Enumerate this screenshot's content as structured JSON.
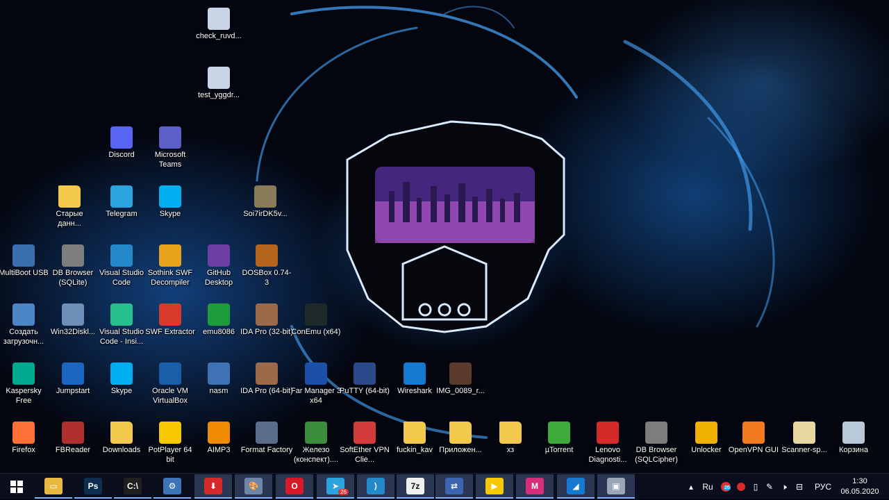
{
  "desktop_icons": [
    {
      "label": "check_ruvd...",
      "icon": "config-file-icon",
      "color": "#c9d4e6"
    },
    {
      "label": "test_yggdr...",
      "icon": "config-file-icon",
      "color": "#c9d4e6"
    },
    {
      "label": "Discord",
      "icon": "discord-icon",
      "color": "#5865f2"
    },
    {
      "label": "Microsoft Teams",
      "icon": "teams-icon",
      "color": "#5b5fc7"
    },
    {
      "label": "Старые данн...",
      "icon": "folder-icon",
      "color": "#f2c94c"
    },
    {
      "label": "Telegram",
      "icon": "telegram-icon",
      "color": "#2aa3de"
    },
    {
      "label": "Skype",
      "icon": "skype-icon",
      "color": "#00aff0"
    },
    {
      "label": "Soi7irDK5v...",
      "icon": "image-file-icon",
      "color": "#8a7a5a"
    },
    {
      "label": "MultiBoot USB",
      "icon": "multiboot-icon",
      "color": "#3a6fb0"
    },
    {
      "label": "DB Browser (SQLite)",
      "icon": "database-icon",
      "color": "#7d7d7d"
    },
    {
      "label": "Visual Studio Code",
      "icon": "vscode-icon",
      "color": "#2489ca"
    },
    {
      "label": "Sothink SWF Decompiler",
      "icon": "sothink-icon",
      "color": "#e7a31b"
    },
    {
      "label": "GitHub Desktop",
      "icon": "github-desktop-icon",
      "color": "#6e3fa3"
    },
    {
      "label": "DOSBox 0.74-3",
      "icon": "dosbox-icon",
      "color": "#b5651d"
    },
    {
      "label": "Создать загрузочн...",
      "icon": "boot-media-icon",
      "color": "#4c86c6"
    },
    {
      "label": "Win32Diskl...",
      "icon": "disk-imager-icon",
      "color": "#6d8fb8"
    },
    {
      "label": "Visual Studio Code - Insi...",
      "icon": "vscode-insiders-icon",
      "color": "#24bf8a"
    },
    {
      "label": "SWF Extractor",
      "icon": "swf-extractor-icon",
      "color": "#d93a2b"
    },
    {
      "label": "emu8086",
      "icon": "emu8086-icon",
      "color": "#1e9c3c"
    },
    {
      "label": "IDA Pro (32-bit)",
      "icon": "ida-pro-icon",
      "color": "#9b6a4b"
    },
    {
      "label": "ConEmu (x64)",
      "icon": "conemu-icon",
      "color": "#1e2a2a"
    },
    {
      "label": "Kaspersky Free",
      "icon": "kaspersky-icon",
      "color": "#00a88e"
    },
    {
      "label": "Jumpstart",
      "icon": "jumpstart-icon",
      "color": "#1c66c2"
    },
    {
      "label": "Skype",
      "icon": "skype-icon",
      "color": "#00aff0"
    },
    {
      "label": "Oracle VM VirtualBox",
      "icon": "virtualbox-icon",
      "color": "#1b5ea8"
    },
    {
      "label": "nasm",
      "icon": "nasm-icon",
      "color": "#3f72b5"
    },
    {
      "label": "IDA Pro (64-bit)",
      "icon": "ida-pro-icon",
      "color": "#9b6a4b"
    },
    {
      "label": "Far Manager 3 x64",
      "icon": "far-manager-icon",
      "color": "#1c4fa8"
    },
    {
      "label": "PuTTY (64-bit)",
      "icon": "putty-icon",
      "color": "#2a4a8a"
    },
    {
      "label": "Wireshark",
      "icon": "wireshark-icon",
      "color": "#1679d1"
    },
    {
      "label": "IMG_0089_r...",
      "icon": "image-file-icon",
      "color": "#5a3a2a"
    },
    {
      "label": "Firefox",
      "icon": "firefox-icon",
      "color": "#ff7139"
    },
    {
      "label": "FBReader",
      "icon": "fbreader-icon",
      "color": "#b03030"
    },
    {
      "label": "Downloads",
      "icon": "folder-icon",
      "color": "#f2c94c"
    },
    {
      "label": "PotPlayer 64 bit",
      "icon": "potplayer-icon",
      "color": "#f6c800"
    },
    {
      "label": "AIMP3",
      "icon": "aimp-icon",
      "color": "#f08a00"
    },
    {
      "label": "Format Factory",
      "icon": "format-factory-icon",
      "color": "#5a6d8a"
    },
    {
      "label": "Железо (конспект)....",
      "icon": "document-icon",
      "color": "#3b8c3b"
    },
    {
      "label": "SoftEther VPN Clie...",
      "icon": "softether-icon",
      "color": "#d33b3b"
    },
    {
      "label": "fuckin_kav",
      "icon": "folder-icon",
      "color": "#f2c94c"
    },
    {
      "label": "Приложен...",
      "icon": "folder-icon",
      "color": "#f2c94c"
    },
    {
      "label": "хз",
      "icon": "folder-icon",
      "color": "#f2c94c"
    },
    {
      "label": "µTorrent",
      "icon": "utorrent-icon",
      "color": "#3cab3c"
    },
    {
      "label": "Lenovo Diagnosti...",
      "icon": "lenovo-diagnostics-icon",
      "color": "#d62a2a"
    },
    {
      "label": "DB Browser (SQLCipher)",
      "icon": "database-icon",
      "color": "#7d7d7d"
    },
    {
      "label": "Unlocker",
      "icon": "unlocker-icon",
      "color": "#f0b000"
    },
    {
      "label": "OpenVPN GUI",
      "icon": "openvpn-icon",
      "color": "#f47a20"
    },
    {
      "label": "Scanner-sp...",
      "icon": "scanner-icon",
      "color": "#e8d7a0"
    },
    {
      "label": "Корзина",
      "icon": "recycle-bin-icon",
      "color": "#b9c9d9"
    }
  ],
  "taskbar": {
    "start_icon": "windows-logo-icon",
    "apps": [
      {
        "name": "file-explorer-icon",
        "glyph": "▭",
        "color": "#e8b740"
      },
      {
        "name": "photoshop-icon",
        "glyph": "Ps",
        "color": "#0e2e4f"
      },
      {
        "name": "terminal-icon",
        "glyph": "C:\\",
        "color": "#202020"
      },
      {
        "name": "control-panel-icon",
        "glyph": "⚙",
        "color": "#3c74b8"
      },
      {
        "name": "downloader-icon",
        "glyph": "⬇",
        "color": "#d42a2a"
      },
      {
        "name": "paint-icon",
        "glyph": "🎨",
        "color": "#6e86a8"
      },
      {
        "name": "opera-icon",
        "glyph": "O",
        "color": "#d71a2a"
      },
      {
        "name": "telegram-icon",
        "glyph": "➤",
        "color": "#2aa3de",
        "badge": "26"
      },
      {
        "name": "vscode-icon",
        "glyph": "⟩",
        "color": "#2489ca"
      },
      {
        "name": "7zip-icon",
        "glyph": "7z",
        "color": "#f0f0f0"
      },
      {
        "name": "network-icon",
        "glyph": "⇄",
        "color": "#3d64b0"
      },
      {
        "name": "potplayer-icon",
        "glyph": "▶",
        "color": "#f6c800"
      },
      {
        "name": "mpc-icon",
        "glyph": "M",
        "color": "#d72e7c"
      },
      {
        "name": "wireshark-icon",
        "glyph": "◢",
        "color": "#1679d1"
      },
      {
        "name": "remote-desktop-icon",
        "glyph": "▣",
        "color": "#9aa6b8"
      }
    ],
    "tray": {
      "language": "Ru",
      "input_indicator": "РУС",
      "badge_count": "26",
      "time": "1:30",
      "date": "06.05.2020"
    }
  }
}
